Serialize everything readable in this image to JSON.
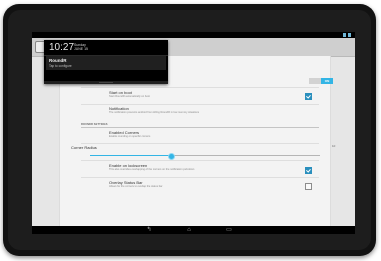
{
  "notification_shade": {
    "time": "10:27",
    "day": "Sunday",
    "date": "JUNE 15",
    "notification": {
      "title": "RoundR",
      "text": "Tap to configure"
    }
  },
  "settings": {
    "enable_label": "Enable RoundR",
    "enable_toggle": "ON",
    "items": [
      {
        "title": "Start on boot",
        "subtitle": "Start RoundR automatically on boot",
        "checked": true
      },
      {
        "title": "Notification",
        "subtitle": "The notification prevents android from killing RoundR in low memory situations",
        "checked": null
      }
    ],
    "section_header": "ROUNDR SETTINGS",
    "enabled_corners": {
      "title": "Enabled Corners",
      "subtitle": "Enable rounding on specific corners"
    },
    "corner_radius": {
      "label": "Corner Radius",
      "value": "10",
      "fraction": 0.35
    },
    "enable_lockscreen": {
      "title": "Enable on lockscreen",
      "subtitle": "This also overrides overlapping of the corners on the notification pull-down",
      "checked": true
    },
    "overlay_status_bar": {
      "title": "Overlay Status Bar",
      "subtitle": "Allows for the corners to overlap the status bar",
      "checked": false
    }
  },
  "navbar": {
    "back": "↰",
    "home": "⌂",
    "recents": "▭"
  },
  "colors": {
    "accent": "#33b5e5",
    "checkbox": "#2a8fbd",
    "shade": "#000000"
  }
}
